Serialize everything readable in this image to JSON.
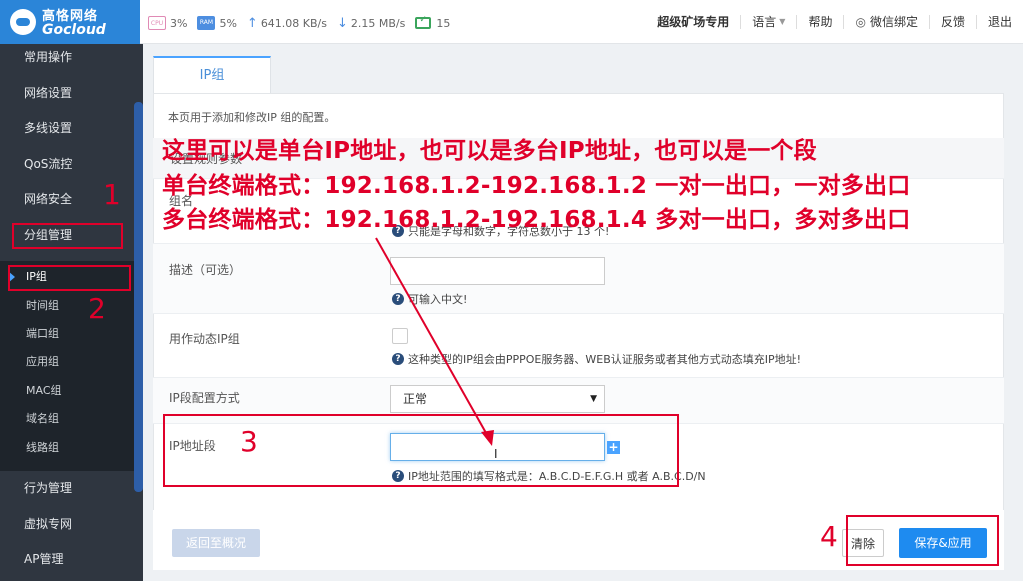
{
  "brand": {
    "name_cn": "高恪网络",
    "name_en": "Gocloud"
  },
  "stats": {
    "cpu_chip": "CPU",
    "cpu": "3%",
    "ram_chip": "RAM",
    "ram": "5%",
    "upload": "641.08 KB/s",
    "download": "2.15 MB/s",
    "online": "15"
  },
  "topnav": {
    "mode": "超级矿场专用",
    "language": "语言",
    "help": "帮助",
    "wechat": "微信绑定",
    "feedback": "反馈",
    "logout": "退出"
  },
  "sidebar": {
    "items": [
      {
        "label": "常用操作"
      },
      {
        "label": "网络设置"
      },
      {
        "label": "多线设置"
      },
      {
        "label": "QoS流控"
      },
      {
        "label": "网络安全"
      },
      {
        "label": "分组管理"
      },
      {
        "label": "行为管理"
      },
      {
        "label": "虚拟专网"
      },
      {
        "label": "AP管理"
      }
    ],
    "sub_items": [
      {
        "label": "IP组",
        "active": true
      },
      {
        "label": "时间组"
      },
      {
        "label": "端口组"
      },
      {
        "label": "应用组"
      },
      {
        "label": "MAC组"
      },
      {
        "label": "域名组"
      },
      {
        "label": "线路组"
      }
    ]
  },
  "page": {
    "tab": "IP组",
    "intro": "本页用于添加和修改IP 组的配置。",
    "section_title": "设置规则参数",
    "group_name_label": "组名",
    "group_name_hint": "只能是字母和数字，字符总数小于 13 个!",
    "desc_label": "描述（可选）",
    "desc_value": "",
    "desc_hint": "可输入中文!",
    "dynamic_label": "用作动态IP组",
    "dynamic_checked": false,
    "dynamic_hint": "这种类型的IP组会由PPPOE服务器、WEB认证服务或者其他方式动态填充IP地址!",
    "mode_label": "IP段配置方式",
    "mode_value": "正常",
    "range_label": "IP地址段",
    "range_value": "",
    "range_hint": "IP地址范围的填写格式是：A.B.C.D-E.F.G.H 或者 A.B.C.D/N",
    "hint_icon": "question-icon"
  },
  "buttons": {
    "back": "返回至概况",
    "clear": "清除",
    "save": "保存&应用"
  },
  "annotations": {
    "line1": "这里可以是单台IP地址，也可以是多台IP地址，也可以是一个段",
    "line2": "单台终端格式：192.168.1.2-192.168.1.2 一对一出口，一对多出口",
    "line3": "多台终端格式：192.168.1.2-192.168.1.4 多对一出口，多对多出口",
    "n1": "1",
    "n2": "2",
    "n3": "3",
    "n4": "4",
    "color": "#e0002a"
  },
  "colors": {
    "brand": "#2b85d8",
    "sidebar": "#2f3640",
    "primary_button": "#1e8bf0"
  }
}
